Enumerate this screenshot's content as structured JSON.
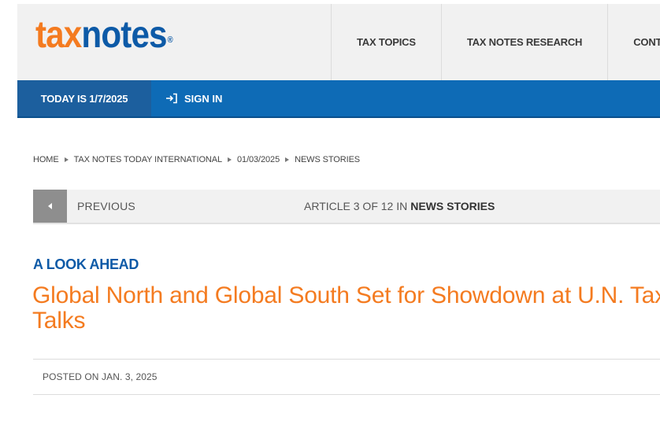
{
  "header": {
    "logo": {
      "part1": "tax",
      "part2": "notes",
      "registered": "®"
    },
    "nav": [
      {
        "label": "TAX TOPICS"
      },
      {
        "label": "TAX NOTES RESEARCH"
      },
      {
        "label": "CONT"
      }
    ]
  },
  "bluebar": {
    "today": "TODAY IS 1/7/2025",
    "signin": "SIGN IN"
  },
  "breadcrumb": [
    "HOME",
    "TAX NOTES TODAY INTERNATIONAL",
    "01/03/2025",
    "NEWS STORIES"
  ],
  "article_nav": {
    "previous": "PREVIOUS",
    "count_prefix": "ARTICLE 3 OF 12 IN",
    "count_section": "NEWS STORIES"
  },
  "article": {
    "kicker": "A LOOK AHEAD",
    "headline": "Global North and Global South Set for Showdown at U.N. Tax Talks",
    "posted": "POSTED ON JAN. 3, 2025"
  },
  "colors": {
    "orange": "#f47b20",
    "blue": "#0d5aa7",
    "bar_blue": "#0e6bb6"
  }
}
